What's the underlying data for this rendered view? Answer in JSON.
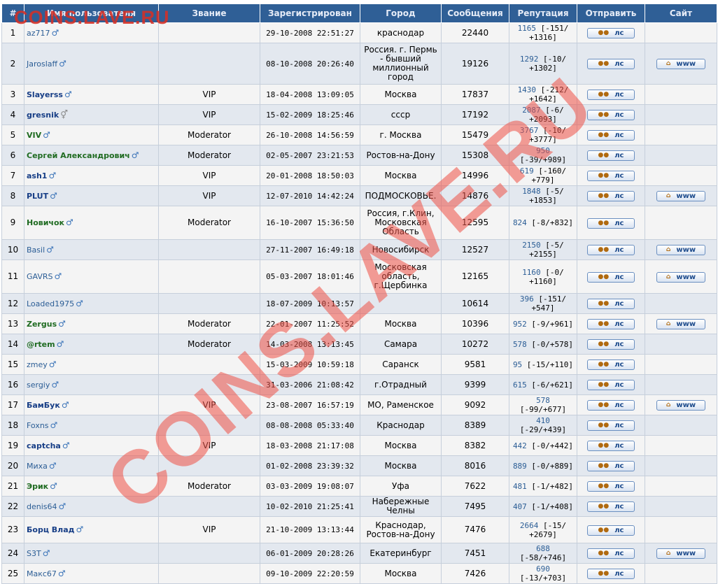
{
  "columns": [
    "#",
    "Имя пользователя",
    "Звание",
    "Зарегистрирован",
    "Город",
    "Сообщения",
    "Репутация",
    "Отправить",
    "Сайт"
  ],
  "buttons": {
    "pm_label": "лс",
    "www_label": "www"
  },
  "watermark": {
    "top": "COINS.LAVE.RU",
    "diagonal": "COINS.LAVE.RU"
  },
  "rows": [
    {
      "n": "1",
      "name": "az717",
      "style": "plain",
      "gender": "male",
      "rank": "",
      "reg": "29-10-2008 22:51:27",
      "city": "краснодар",
      "posts": "22440",
      "rep_val": "1165",
      "rep_rest": " [-151/ +1316]",
      "site": false
    },
    {
      "n": "2",
      "name": "Jaroslaff",
      "style": "plain",
      "gender": "male",
      "rank": "",
      "reg": "08-10-2008 20:26:40",
      "city": "Россия. г. Пермь - бывший миллионный город",
      "posts": "19126",
      "rep_val": "1292",
      "rep_rest": " [-10/ +1302]",
      "site": true
    },
    {
      "n": "3",
      "name": "Slayerss",
      "style": "vip",
      "gender": "male",
      "rank": "VIP",
      "reg": "18-04-2008 13:09:05",
      "city": "Москва",
      "posts": "17837",
      "rep_val": "1430",
      "rep_rest": " [-212/ +1642]",
      "site": false
    },
    {
      "n": "4",
      "name": "gresnik",
      "style": "vip",
      "gender": "unknown",
      "rank": "VIP",
      "reg": "15-02-2009 18:25:46",
      "city": "ссср",
      "posts": "17192",
      "rep_val": "2087",
      "rep_rest": " [-6/ +2093]",
      "site": false
    },
    {
      "n": "5",
      "name": "VIV",
      "style": "mod",
      "gender": "male",
      "rank": "Moderator",
      "reg": "26-10-2008 14:56:59",
      "city": "г. Москва",
      "posts": "15479",
      "rep_val": "3767",
      "rep_rest": " [-10/ +3777]",
      "site": false
    },
    {
      "n": "6",
      "name": "Сергей Александрович",
      "style": "mod",
      "gender": "male",
      "rank": "Moderator",
      "reg": "02-05-2007 23:21:53",
      "city": "Ростов-на-Дону",
      "posts": "15308",
      "rep_val": "950",
      "rep_rest": " [-39/+989]",
      "site": false
    },
    {
      "n": "7",
      "name": "ash1",
      "style": "vip",
      "gender": "male",
      "rank": "VIP",
      "reg": "20-01-2008 18:50:03",
      "city": "Москва",
      "posts": "14996",
      "rep_val": "619",
      "rep_rest": " [-160/ +779]",
      "site": false
    },
    {
      "n": "8",
      "name": "PLUT",
      "style": "vip",
      "gender": "male",
      "rank": "VIP",
      "reg": "12-07-2010 14:42:24",
      "city": "ПОДМОСКОВЬЕ.",
      "posts": "14876",
      "rep_val": "1848",
      "rep_rest": " [-5/ +1853]",
      "site": true
    },
    {
      "n": "9",
      "name": "Новичок",
      "style": "mod",
      "gender": "male",
      "rank": "Moderator",
      "reg": "16-10-2007 15:36:50",
      "city": "Россия, г.Клин, Московская Область",
      "posts": "12595",
      "rep_val": "824",
      "rep_rest": " [-8/+832]",
      "site": false
    },
    {
      "n": "10",
      "name": "Basil",
      "style": "plain",
      "gender": "male",
      "rank": "",
      "reg": "27-11-2007 16:49:18",
      "city": "Новосибирск",
      "posts": "12527",
      "rep_val": "2150",
      "rep_rest": " [-5/ +2155]",
      "site": true
    },
    {
      "n": "11",
      "name": "GAVRS",
      "style": "plain",
      "gender": "male",
      "rank": "",
      "reg": "05-03-2007 18:01:46",
      "city": "Московская область, г.Щербинка",
      "posts": "12165",
      "rep_val": "1160",
      "rep_rest": " [-0/ +1160]",
      "site": true
    },
    {
      "n": "12",
      "name": "Loaded1975",
      "style": "plain",
      "gender": "male",
      "rank": "",
      "reg": "18-07-2009 10:13:57",
      "city": "",
      "posts": "10614",
      "rep_val": "396",
      "rep_rest": " [-151/ +547]",
      "site": false
    },
    {
      "n": "13",
      "name": "Zergus",
      "style": "mod",
      "gender": "male",
      "rank": "Moderator",
      "reg": "22-01-2007 11:25:52",
      "city": "Москва",
      "posts": "10396",
      "rep_val": "952",
      "rep_rest": " [-9/+961]",
      "site": true
    },
    {
      "n": "14",
      "name": "@rtem",
      "style": "mod",
      "gender": "male",
      "rank": "Moderator",
      "reg": "14-03-2008 13:13:45",
      "city": "Самара",
      "posts": "10272",
      "rep_val": "578",
      "rep_rest": " [-0/+578]",
      "site": false
    },
    {
      "n": "15",
      "name": "zmey",
      "style": "plain",
      "gender": "male",
      "rank": "",
      "reg": "15-03-2009 10:59:18",
      "city": "Саранск",
      "posts": "9581",
      "rep_val": "95",
      "rep_rest": " [-15/+110]",
      "site": false
    },
    {
      "n": "16",
      "name": "sergiy",
      "style": "plain",
      "gender": "male",
      "rank": "",
      "reg": "31-03-2006 21:08:42",
      "city": "г.Отрадный",
      "posts": "9399",
      "rep_val": "615",
      "rep_rest": " [-6/+621]",
      "site": false
    },
    {
      "n": "17",
      "name": "БамБук",
      "style": "vip",
      "gender": "male",
      "rank": "VIP",
      "reg": "23-08-2007 16:57:19",
      "city": "МО, Раменское",
      "posts": "9092",
      "rep_val": "578",
      "rep_rest": " [-99/+677]",
      "site": true
    },
    {
      "n": "18",
      "name": "Foxns",
      "style": "plain",
      "gender": "male",
      "rank": "",
      "reg": "08-08-2008 05:33:40",
      "city": "Краснодар",
      "posts": "8389",
      "rep_val": "410",
      "rep_rest": " [-29/+439]",
      "site": false
    },
    {
      "n": "19",
      "name": "captcha",
      "style": "vip",
      "gender": "male",
      "rank": "VIP",
      "reg": "18-03-2008 21:17:08",
      "city": "Москва",
      "posts": "8382",
      "rep_val": "442",
      "rep_rest": " [-0/+442]",
      "site": false
    },
    {
      "n": "20",
      "name": "Миха",
      "style": "plain",
      "gender": "male",
      "rank": "",
      "reg": "01-02-2008 23:39:32",
      "city": "Москва",
      "posts": "8016",
      "rep_val": "889",
      "rep_rest": " [-0/+889]",
      "site": false
    },
    {
      "n": "21",
      "name": "Эрик",
      "style": "mod",
      "gender": "male",
      "rank": "Moderator",
      "reg": "03-03-2009 19:08:07",
      "city": "Уфа",
      "posts": "7622",
      "rep_val": "481",
      "rep_rest": " [-1/+482]",
      "site": false
    },
    {
      "n": "22",
      "name": "denis64",
      "style": "plain",
      "gender": "male",
      "rank": "",
      "reg": "10-02-2010 21:25:41",
      "city": "Набережные Челны",
      "posts": "7495",
      "rep_val": "407",
      "rep_rest": " [-1/+408]",
      "site": false
    },
    {
      "n": "23",
      "name": "Борц Влад",
      "style": "vip",
      "gender": "male",
      "rank": "VIP",
      "reg": "21-10-2009 13:13:44",
      "city": "Краснодар, Ростов-на-Дону",
      "posts": "7476",
      "rep_val": "2664",
      "rep_rest": " [-15/ +2679]",
      "site": false
    },
    {
      "n": "24",
      "name": "S3T",
      "style": "plain",
      "gender": "male",
      "rank": "",
      "reg": "06-01-2009 20:28:26",
      "city": "Екатеринбург",
      "posts": "7451",
      "rep_val": "688",
      "rep_rest": " [-58/+746]",
      "site": true
    },
    {
      "n": "25",
      "name": "Макс67",
      "style": "plain",
      "gender": "male",
      "rank": "",
      "reg": "09-10-2009 22:20:59",
      "city": "Москва",
      "posts": "7426",
      "rep_val": "690",
      "rep_rest": " [-13/+703]",
      "site": false
    }
  ]
}
